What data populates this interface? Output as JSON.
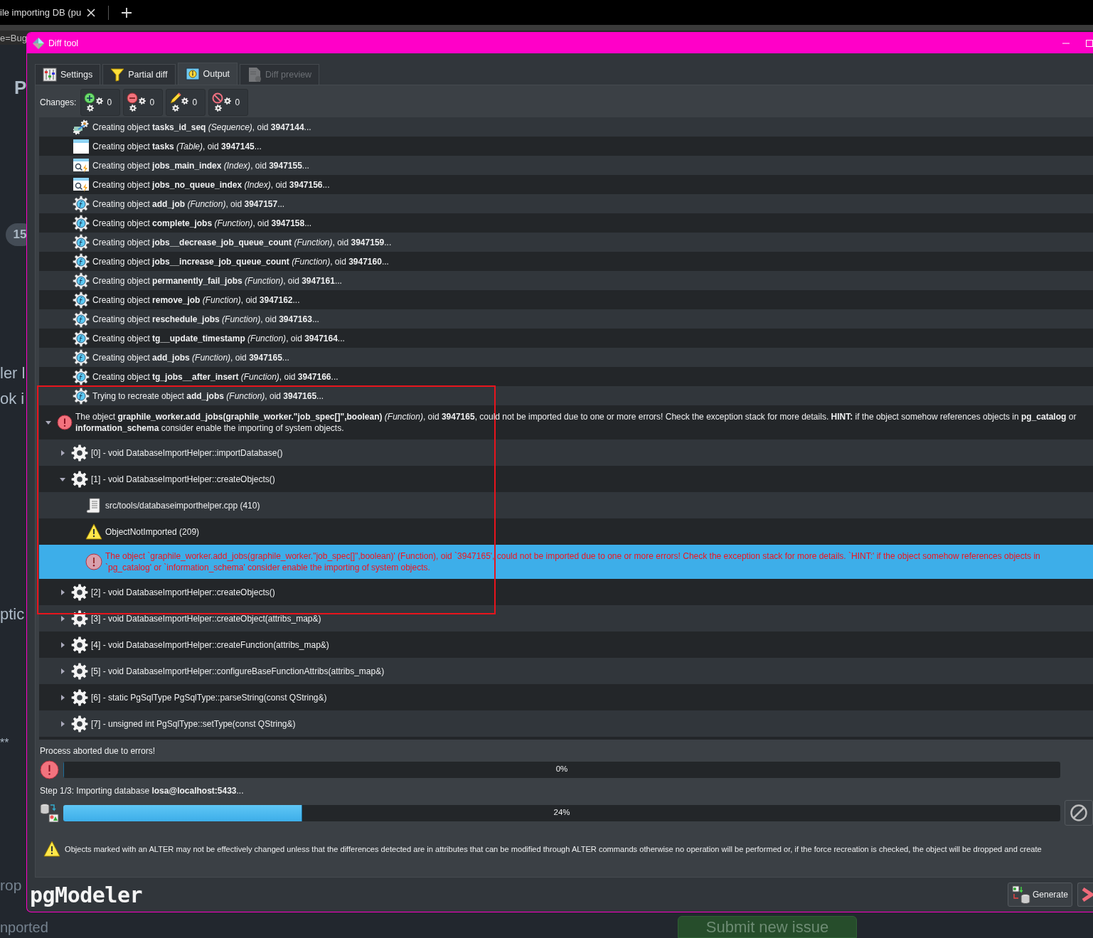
{
  "browser": {
    "tab_title": "ile importing DB (pu"
  },
  "background_page": {
    "address": "e=Bug",
    "heading": "P",
    "badge": "15",
    "fragments": [
      "ler l",
      "ok i",
      "ptic",
      "**",
      "rop",
      "nported"
    ],
    "button": "Submit new issue"
  },
  "window": {
    "title": "Diff tool"
  },
  "tabs": [
    {
      "label": "Settings",
      "kind": "settings",
      "selected": false,
      "disabled": false
    },
    {
      "label": "Partial diff",
      "kind": "filter",
      "selected": false,
      "disabled": false
    },
    {
      "label": "Output",
      "kind": "output",
      "selected": true,
      "disabled": false
    },
    {
      "label": "Diff preview",
      "kind": "preview",
      "selected": false,
      "disabled": true
    }
  ],
  "changes": {
    "label": "Changes:",
    "counters": [
      {
        "kind": "create",
        "count": "0"
      },
      {
        "kind": "drop",
        "count": "0"
      },
      {
        "kind": "alter",
        "count": "0"
      },
      {
        "kind": "ignore",
        "count": "0"
      }
    ]
  },
  "output_tree": [
    {
      "kind": "sequence",
      "text": "Creating object **tasks_id_seq** *(Sequence)*, oid **3947144**...",
      "selected": false
    },
    {
      "kind": "table",
      "text": "Creating object **tasks** *(Table)*, oid **3947145**...",
      "selected": false
    },
    {
      "kind": "index",
      "text": "Creating object **jobs_main_index** *(Index)*, oid **3947155**...",
      "selected": false
    },
    {
      "kind": "index",
      "text": "Creating object **jobs_no_queue_index** *(Index)*, oid **3947156**...",
      "selected": false
    },
    {
      "kind": "function",
      "text": "Creating object **add_job** *(Function)*, oid **3947157**...",
      "selected": false
    },
    {
      "kind": "function",
      "text": "Creating object **complete_jobs** *(Function)*, oid **3947158**...",
      "selected": false
    },
    {
      "kind": "function",
      "text": "Creating object **jobs__decrease_job_queue_count** *(Function)*, oid **3947159**...",
      "selected": false
    },
    {
      "kind": "function",
      "text": "Creating object **jobs__increase_job_queue_count** *(Function)*, oid **3947160**...",
      "selected": false
    },
    {
      "kind": "function",
      "text": "Creating object **permanently_fail_jobs** *(Function)*, oid **3947161**...",
      "selected": false
    },
    {
      "kind": "function",
      "text": "Creating object **remove_job** *(Function)*, oid **3947162**...",
      "selected": false
    },
    {
      "kind": "function",
      "text": "Creating object **reschedule_jobs** *(Function)*, oid **3947163**...",
      "selected": false
    },
    {
      "kind": "function",
      "text": "Creating object **tg__update_timestamp** *(Function)*, oid **3947164**...",
      "selected": false
    },
    {
      "kind": "function",
      "text": "Creating object **add_jobs** *(Function)*, oid **3947165**...",
      "selected": false
    },
    {
      "kind": "function",
      "text": "Creating object **tg_jobs__after_insert** *(Function)*, oid **3947166**...",
      "selected": false
    },
    {
      "kind": "function",
      "text": "Trying to recreate object **add_jobs** *(Function)*, oid **3947165**...",
      "selected": false
    },
    {
      "kind": "error",
      "text": "The object **graphile_worker.add_jobs(graphile_worker.\"job_spec[]\",boolean)** *(Function)*, oid **3947165**, could not be imported due to one or more errors! Check the exception stack for more details. **HINT:** if the object somehow references objects in **pg_catalog** or **information_schema** consider enable the importing of system objects.",
      "selected": false,
      "expanded": true,
      "children": [
        {
          "kind": "frame",
          "text": "[0] - void DatabaseImportHelper::importDatabase()",
          "selected": false,
          "expanded": false
        },
        {
          "kind": "frame",
          "text": "[1] - void DatabaseImportHelper::createObjects()",
          "selected": false,
          "expanded": true,
          "children": [
            {
              "kind": "file",
              "text": "src/tools/databaseimporthelper.cpp (410)",
              "selected": false
            },
            {
              "kind": "warning",
              "text": "ObjectNotImported (209)",
              "selected": false
            },
            {
              "kind": "message",
              "text": "The object `graphile_worker.add_jobs(graphile_worker.\"job_spec[]\",boolean)' (Function), oid `3947165', could not be imported due to one or more errors! Check the exception stack for more details. `HINT:' if the object somehow references objects in `pg_catalog' or `information_schema' consider enable the importing of system objects.",
              "selected": true
            }
          ]
        },
        {
          "kind": "frame",
          "text": "[2] - void DatabaseImportHelper::createObjects()",
          "selected": false,
          "expanded": false
        },
        {
          "kind": "frame",
          "text": "[3] - void DatabaseImportHelper::createObject(attribs_map&)",
          "selected": false,
          "expanded": false
        },
        {
          "kind": "frame",
          "text": "[4] - void DatabaseImportHelper::createFunction(attribs_map&)",
          "selected": false,
          "expanded": false
        },
        {
          "kind": "frame",
          "text": "[5] - void DatabaseImportHelper::configureBaseFunctionAttribs(attribs_map&)",
          "selected": false,
          "expanded": false
        },
        {
          "kind": "frame",
          "text": "[6] - static PgSqlType PgSqlType::parseString(const QString&)",
          "selected": false,
          "expanded": false
        },
        {
          "kind": "frame",
          "text": "[7] - unsigned int PgSqlType::setType(const QString&)",
          "selected": false,
          "expanded": false
        }
      ]
    }
  ],
  "progress": {
    "status": "Process aborted due to errors!",
    "status_bar": {
      "level": 0,
      "reading": "0%"
    },
    "step": "Step 1/3: Importing database **losa@localhost:5433**...",
    "step_bar": {
      "level": 0.24,
      "reading": "24%"
    }
  },
  "note": "Objects marked with an ALTER may not be effectively changed unless that the differences detected are in attributes that can be modified through ALTER commands otherwise no operation will be performed or, if the force recreation is checked, the object will be dropped and create",
  "footer": {
    "logo": "pgModeler",
    "generate_button": "Generate"
  },
  "annotation": {
    "kind": "rectangle"
  }
}
